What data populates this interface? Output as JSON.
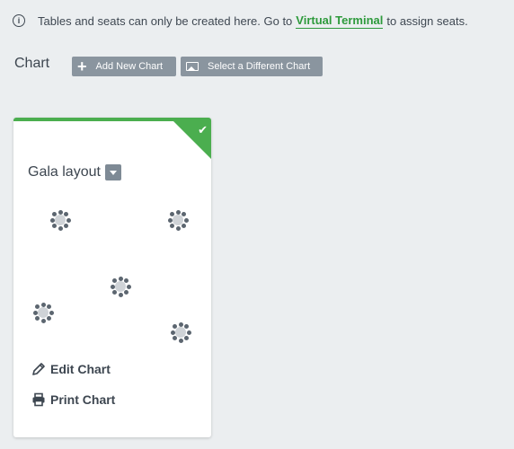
{
  "info": {
    "text_before": "Tables and seats can only be created here. Go to",
    "link_text": "Virtual Terminal",
    "text_after": "to assign seats."
  },
  "chart_section": {
    "heading": "Chart",
    "add_button": "Add New Chart",
    "select_button": "Select a Different Chart"
  },
  "card": {
    "title": "Gala layout",
    "selected": true,
    "table_count": 5,
    "edit_label": "Edit Chart",
    "print_label": "Print Chart"
  },
  "colors": {
    "accent_green": "#4bae4f",
    "link_green": "#2e9a3c",
    "button_gray": "#8a959f",
    "background": "#ebeef0"
  }
}
